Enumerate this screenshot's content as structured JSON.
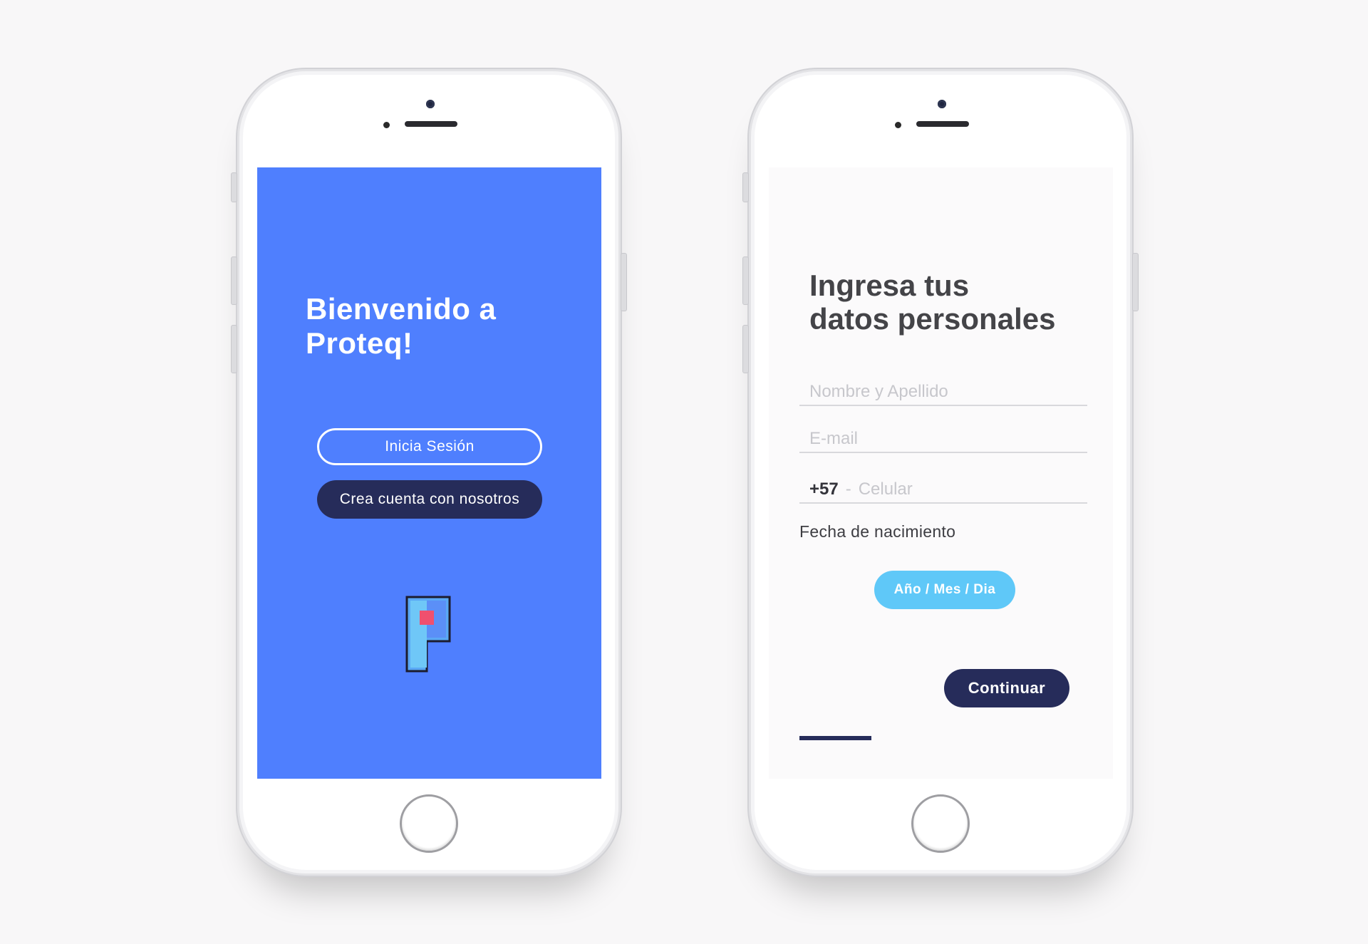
{
  "welcome_screen": {
    "title_line1": "Bienvenido a",
    "title_line2": "Proteq!",
    "login_label": "Inicia Sesión",
    "signup_label": "Crea cuenta con nosotros",
    "logo_icon": "proteq-logo-icon"
  },
  "personal_data_screen": {
    "title_line1": "Ingresa tus",
    "title_line2": "datos personales",
    "name_placeholder": "Nombre y Apellido",
    "email_placeholder": "E-mail",
    "phone_prefix": "+57",
    "phone_separator": "-",
    "phone_placeholder": "Celular",
    "dob_label": "Fecha de nacimiento",
    "date_button_label": "Año / Mes / Dia",
    "continue_label": "Continuar"
  },
  "colors": {
    "primary_blue": "#4f7ffe",
    "dark_navy": "#262c5a",
    "light_blue": "#5fc8f8",
    "logo_accent": "#f0506e"
  }
}
